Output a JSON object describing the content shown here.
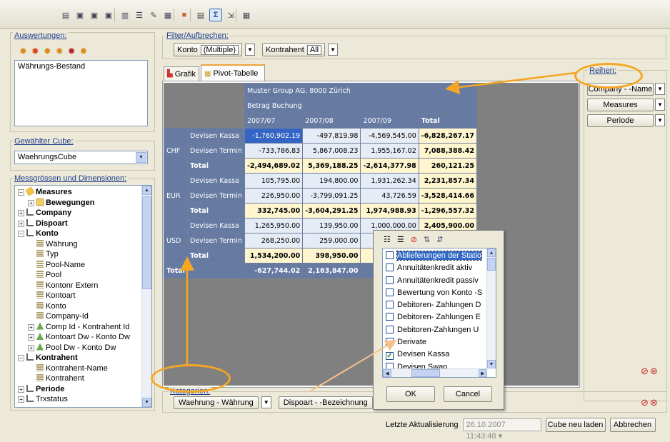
{
  "toolbar": {
    "icons": [
      "pivot-icon",
      "cube-icon",
      "cube-icon",
      "cube-icon",
      "chart-icon",
      "list-icon",
      "magic-icon",
      "table-icon",
      "color-icon",
      "layout-icon",
      "sum-icon",
      "export-icon",
      "grid-icon"
    ]
  },
  "auswertungen": {
    "label": "Auswertungen:",
    "items": [
      "Währungs-Bestand"
    ]
  },
  "cube": {
    "label": "Gewählter Cube:",
    "value": "WaehrungsCube"
  },
  "mess": {
    "label": "Messgrössen und Dimensionen:",
    "tree": [
      {
        "t": "Measures",
        "lvl": 0,
        "pm": "-",
        "ic": "measure",
        "b": true
      },
      {
        "t": "Bewegungen",
        "lvl": 1,
        "pm": "+",
        "ic": "folder",
        "b": true
      },
      {
        "t": "Company",
        "lvl": 0,
        "pm": "+",
        "ic": "dim",
        "b": true
      },
      {
        "t": "Dispoart",
        "lvl": 0,
        "pm": "+",
        "ic": "dim",
        "b": true
      },
      {
        "t": "Konto",
        "lvl": 0,
        "pm": "-",
        "ic": "dim",
        "b": true
      },
      {
        "t": "Währung",
        "lvl": 1,
        "pm": "",
        "ic": "attr"
      },
      {
        "t": "Typ",
        "lvl": 1,
        "pm": "",
        "ic": "attr"
      },
      {
        "t": "Pool-Name",
        "lvl": 1,
        "pm": "",
        "ic": "attr"
      },
      {
        "t": "Pool",
        "lvl": 1,
        "pm": "",
        "ic": "attr"
      },
      {
        "t": "Kontonr Extern",
        "lvl": 1,
        "pm": "",
        "ic": "attr"
      },
      {
        "t": "Kontoart",
        "lvl": 1,
        "pm": "",
        "ic": "attr"
      },
      {
        "t": "Konto",
        "lvl": 1,
        "pm": "",
        "ic": "attr"
      },
      {
        "t": "Company-Id",
        "lvl": 1,
        "pm": "",
        "ic": "attr"
      },
      {
        "t": "Comp Id - Kontrahent Id",
        "lvl": 1,
        "pm": "+",
        "ic": "hier"
      },
      {
        "t": "Kontoart Dw - Konto Dw",
        "lvl": 1,
        "pm": "+",
        "ic": "hier"
      },
      {
        "t": "Pool Dw - Konto Dw",
        "lvl": 1,
        "pm": "+",
        "ic": "hier"
      },
      {
        "t": "Kontrahent",
        "lvl": 0,
        "pm": "-",
        "ic": "dim",
        "b": true
      },
      {
        "t": "Kontrahent-Name",
        "lvl": 1,
        "pm": "",
        "ic": "attr"
      },
      {
        "t": "Kontrahent",
        "lvl": 1,
        "pm": "",
        "ic": "attr"
      },
      {
        "t": "Periode",
        "lvl": 0,
        "pm": "+",
        "ic": "dim",
        "b": true
      },
      {
        "t": "Trxstatus",
        "lvl": 0,
        "pm": "+",
        "ic": "dim"
      }
    ]
  },
  "filter": {
    "label": "Filter/Aufbrechen:",
    "konto_label": "Konto",
    "konto_value": "(Multiple)",
    "kontrahent_label": "Kontrahent",
    "kontrahent_value": "All"
  },
  "tabs": [
    "Grafik",
    "Pivot-Tabelle"
  ],
  "pivot": {
    "company": "Muster Group AG, 8000 Zürich",
    "measure": "Betrag Buchung",
    "periods": [
      "2007/07",
      "2007/08",
      "2007/09"
    ],
    "total_label": "Total",
    "groups": [
      {
        "cur": "CHF",
        "rows": [
          {
            "label": "Devisen Kassa",
            "vals": [
              "-1,760,902.19",
              "-497,819.98",
              "-4,569,545.00"
            ],
            "total": "-6,828,267.17"
          },
          {
            "label": "Devisen Termin",
            "vals": [
              "-733,786.83",
              "5,867,008.23",
              "1,955,167.02"
            ],
            "total": "7,088,388.42"
          },
          {
            "label": "Total",
            "vals": [
              "-2,494,689.02",
              "5,369,188.25",
              "-2,614,377.98"
            ],
            "total": "260,121.25"
          }
        ]
      },
      {
        "cur": "EUR",
        "rows": [
          {
            "label": "Devisen Kassa",
            "vals": [
              "105,795.00",
              "194,800.00",
              "1,931,262.34"
            ],
            "total": "2,231,857.34"
          },
          {
            "label": "Devisen Termin",
            "vals": [
              "226,950.00",
              "-3,799,091.25",
              "43,726.59"
            ],
            "total": "-3,528,414.66"
          },
          {
            "label": "Total",
            "vals": [
              "332,745.00",
              "-3,604,291.25",
              "1,974,988.93"
            ],
            "total": "-1,296,557.32"
          }
        ]
      },
      {
        "cur": "USD",
        "rows": [
          {
            "label": "Devisen Kassa",
            "vals": [
              "1,265,950.00",
              "139,950.00",
              "1,000,000.00"
            ],
            "total": "2,405,900.00"
          },
          {
            "label": "Devisen Termin",
            "vals": [
              "268,250.00",
              "259,000.00",
              "-1,..."
            ],
            "total": "1,137,884.80"
          },
          {
            "label": "Total",
            "vals": [
              "1,534,200.00",
              "398,950.00",
              "-..."
            ],
            "total": ""
          }
        ]
      }
    ],
    "grand": {
      "label": "Total",
      "vals": [
        "-627,744.02",
        "2,163,847.00",
        "-1,2..."
      ]
    }
  },
  "reihen": {
    "label": "Reihen:",
    "items": [
      "Company - -Name",
      "Measures",
      "Periode"
    ]
  },
  "kategorien": {
    "label": "Kategorien:",
    "items": [
      "Waehrung - Währung",
      "Dispoart - -Bezeichnung"
    ]
  },
  "popup": {
    "items": [
      {
        "t": "Ablieferungen der Statio",
        "c": false,
        "sel": true
      },
      {
        "t": "Annuitätenkredit aktiv",
        "c": false
      },
      {
        "t": "Annuitätenkredit passiv",
        "c": false
      },
      {
        "t": "Bewertung von Konto -S",
        "c": false
      },
      {
        "t": "Debitoren- Zahlungen D",
        "c": false
      },
      {
        "t": "Debitoren- Zahlungen E",
        "c": false
      },
      {
        "t": "Debitoren-Zahlungen U",
        "c": false
      },
      {
        "t": "Derivate",
        "c": false
      },
      {
        "t": "Devisen Kassa",
        "c": true
      },
      {
        "t": "Devisen Swap",
        "c": false
      },
      {
        "t": "Devisen Termin",
        "c": true
      },
      {
        "t": "Di...",
        "c": false
      }
    ],
    "ok": "OK",
    "cancel": "Cancel"
  },
  "footer": {
    "label": "Letzte Aktualisierung",
    "timestamp": "26.10.2007 11:43:48",
    "reload": "Cube neu laden",
    "abort": "Abbrechen"
  },
  "colors": {
    "highlight": "#f5a623",
    "header": "#667aa2",
    "selected": "#3465c4"
  }
}
